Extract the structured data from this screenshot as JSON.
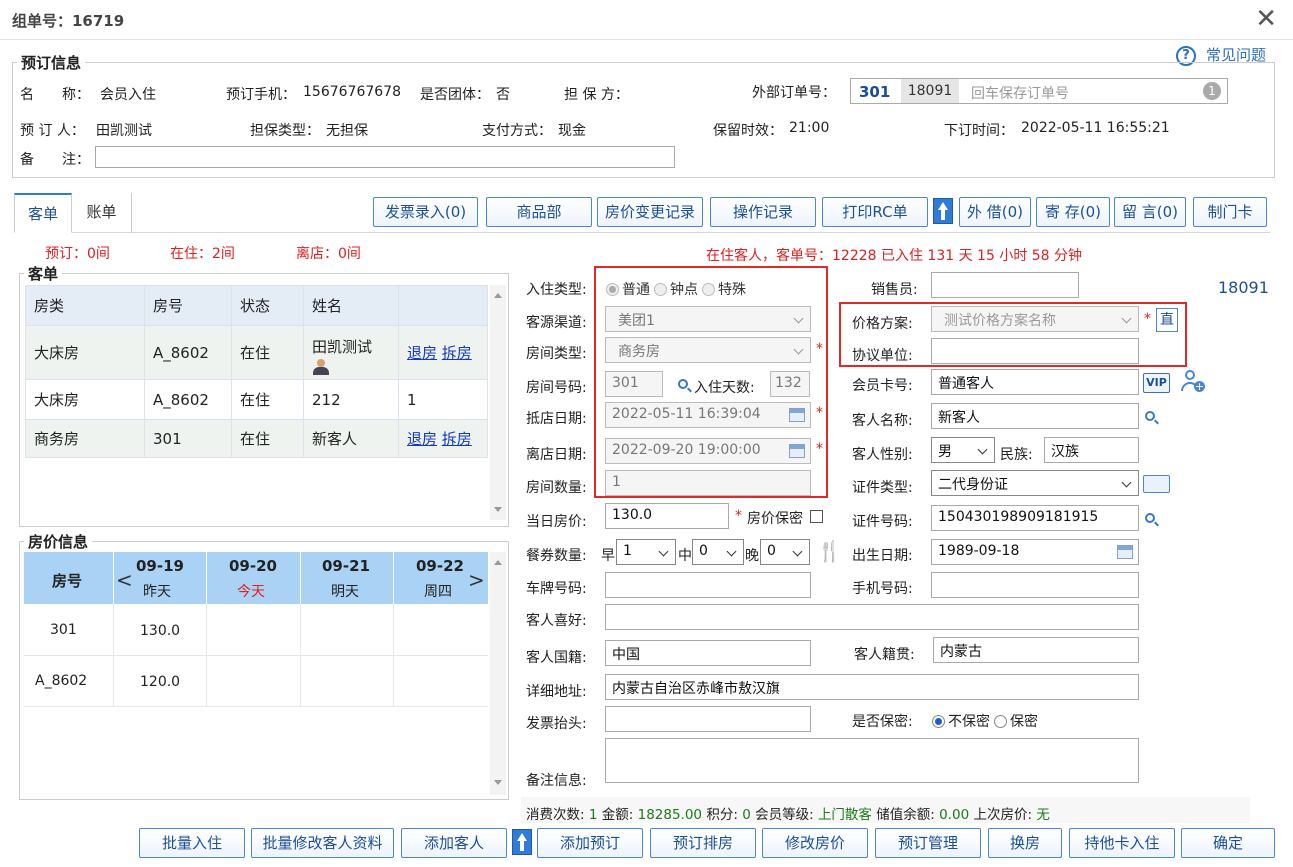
{
  "window": {
    "title": "组单号：16719",
    "faq": "常见问题"
  },
  "booking": {
    "legend": "预订信息",
    "name_label": "名　　称：",
    "name": "会员入住",
    "phone_label": "预订手机：",
    "phone": "15676767678",
    "group_label": "是否团体：",
    "group": "否",
    "guarantor_label": "担 保 方：",
    "ext_order_label": "外部订单号：",
    "ext_a": "301",
    "ext_b": "18091",
    "ext_placeholder": "回车保存订单号",
    "ext_badge": "1",
    "booker_label": "预 订 人：",
    "booker": "田凯测试",
    "guarantee_type_label": "担保类型：",
    "guarantee_type": "无担保",
    "pay_label": "支付方式：",
    "pay": "现金",
    "hold_label": "保留时效：",
    "hold": "21:00",
    "order_time_label": "下订时间：",
    "order_time": "2022-05-11 16:55:21",
    "note_label": "备　　注："
  },
  "tabs": {
    "guest": "客单",
    "bill": "账单"
  },
  "toolbar": [
    "发票录入(0)",
    "商品部",
    "房价变更记录",
    "操作记录",
    "打印RC单",
    "外 借(0)",
    "寄 存(0)",
    "留 言(0)",
    "制门卡"
  ],
  "counts": {
    "reserved": "预订：0间",
    "staying": "在住：2间",
    "departed": "离店：0间"
  },
  "status_line": "在住客人，客单号：12228 已入住 131 天 15 小时 58 分钟",
  "guest_list": {
    "legend": "客单",
    "headers": [
      "房类",
      "房号",
      "状态",
      "姓名",
      ""
    ],
    "rows": [
      {
        "type": "大床房",
        "room": "A_8602",
        "status": "在住",
        "name": "田凯测试",
        "a1": "退房",
        "a2": "拆房"
      },
      {
        "type": "大床房",
        "room": "A_8602",
        "status": "在住",
        "name": "212",
        "extra": "1"
      },
      {
        "type": "商务房",
        "room": "301",
        "status": "在住",
        "name": "新客人",
        "a1": "退房",
        "a2": "拆房"
      }
    ]
  },
  "price_info": {
    "legend": "房价信息",
    "room_header": "房号",
    "days": [
      {
        "date": "09-19",
        "label": "昨天"
      },
      {
        "date": "09-20",
        "label": "今天"
      },
      {
        "date": "09-21",
        "label": "明天"
      },
      {
        "date": "09-22",
        "label": "周四"
      }
    ],
    "rows": [
      {
        "room": "301",
        "price": "130.0"
      },
      {
        "room": "A_8602",
        "price": "120.0"
      }
    ]
  },
  "form": {
    "checkin_type_label": "入住类型:",
    "checkin_types": [
      "普通",
      "钟点",
      "特殊"
    ],
    "source_label": "客源渠道:",
    "source": "美团1",
    "room_type_label": "房间类型:",
    "room_type": "商务房",
    "room_no_label": "房间号码:",
    "room_no": "301",
    "days_label": "入住天数:",
    "days": "132",
    "arrive_label": "抵店日期:",
    "arrive": "2022-05-11 16:39:04",
    "depart_label": "离店日期:",
    "depart": "2022-09-20 19:00:00",
    "room_count_label": "房间数量:",
    "room_count": "1",
    "day_price_label": "当日房价:",
    "day_price": "130.0",
    "price_secret_label": "房价保密",
    "meal_label": "餐券数量:",
    "breakfast_label": "早",
    "breakfast": "1",
    "lunch_label": "中",
    "lunch": "0",
    "dinner_label": "晚",
    "dinner": "0",
    "plate_label": "车牌号码:",
    "hobby_label": "客人喜好:",
    "nationality_label": "客人国籍:",
    "nationality": "中国",
    "address_label": "详细地址:",
    "address": "内蒙古自治区赤峰市敖汉旗",
    "invoice_label": "发票抬头:",
    "remark_label": "备注信息:",
    "sales_label": "销售员:",
    "sales_code": "18091",
    "price_plan_label": "价格方案:",
    "price_plan": "测试价格方案名称",
    "direct": "直",
    "agreement_label": "协议单位:",
    "member_label": "会员卡号:",
    "member": "普通客人",
    "vip": "VIP",
    "guest_name_label": "客人名称:",
    "guest_name": "新客人",
    "gender_label": "客人性别:",
    "gender": "男",
    "ethnic_label": "民族:",
    "ethnic": "汉族",
    "id_type_label": "证件类型:",
    "id_type": "二代身份证",
    "id_no_label": "证件号码:",
    "id_no": "150430198909181915",
    "birth_label": "出生日期:",
    "birth": "1989-09-18",
    "mobile_label": "手机号码:",
    "origin_label": "客人籍贯:",
    "origin": "内蒙古",
    "secret_label": "是否保密:",
    "secret_options": [
      "不保密",
      "保密"
    ]
  },
  "summary": {
    "count_label": "消费次数:",
    "count": "1",
    "amount_label": "金额:",
    "amount": "18285.00",
    "points_label": "积分:",
    "points": "0",
    "level_label": "会员等级:",
    "level": "上门散客",
    "balance_label": "储值余额:",
    "balance": "0.00",
    "last_label": "上次房价:",
    "last": "无"
  },
  "bottom_buttons": [
    "批量入住",
    "批量修改客人资料",
    "添加客人",
    "添加预订",
    "预订排房",
    "修改房价",
    "预订管理",
    "换房",
    "持他卡入住",
    "确定"
  ]
}
